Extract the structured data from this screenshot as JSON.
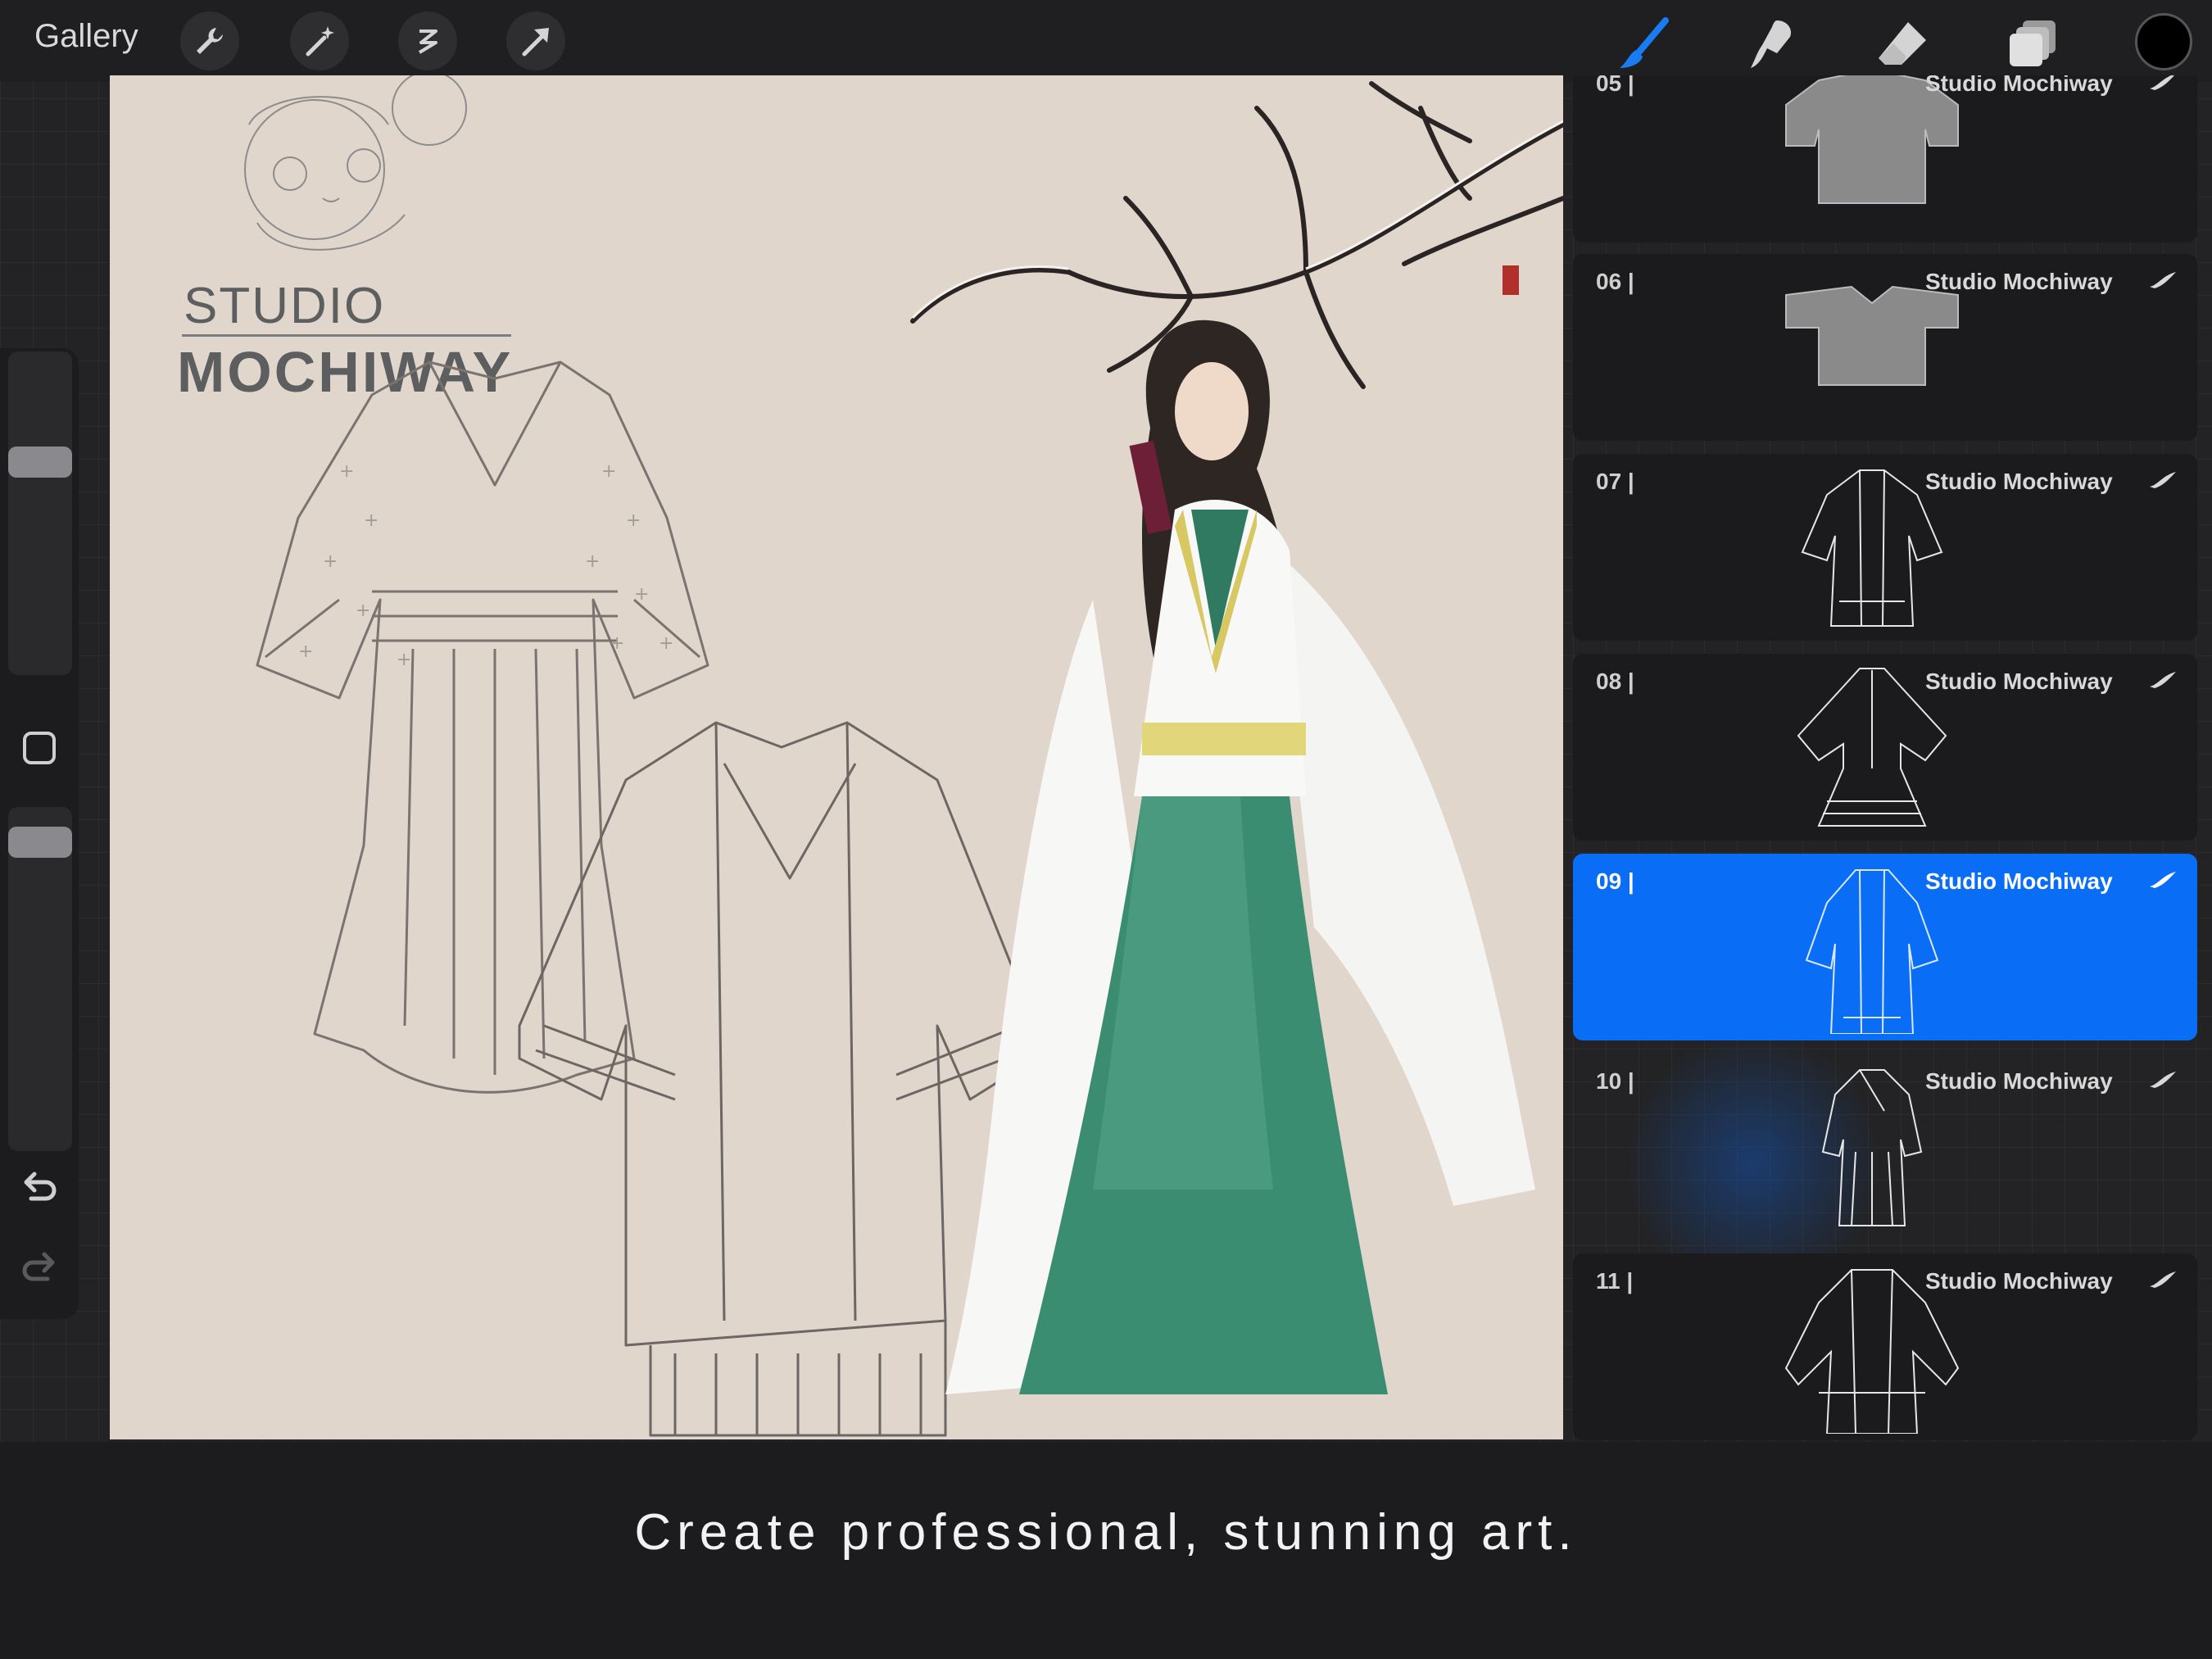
{
  "topbar": {
    "gallery_label": "Gallery",
    "left_tools": [
      "wrench-icon",
      "magic-wand-icon",
      "selection-icon",
      "transform-arrow-icon"
    ],
    "right_tools": [
      "brush-icon",
      "smudge-icon",
      "eraser-icon",
      "layers-icon"
    ],
    "active_tool": "brush-icon",
    "accent": "#1a7cf2",
    "current_color": "#000000"
  },
  "sidebar": {
    "controls": [
      "brush-size-slider",
      "modify-button",
      "opacity-slider",
      "undo-icon",
      "redo-icon"
    ]
  },
  "canvas": {
    "logo_line1": "STUDIO",
    "logo_line2": "MOCHIWAY"
  },
  "layers": {
    "items": [
      {
        "number": "05 |",
        "name": "Studio Mochiway",
        "active": false
      },
      {
        "number": "06 |",
        "name": "Studio Mochiway",
        "active": false
      },
      {
        "number": "07 |",
        "name": "Studio Mochiway",
        "active": false
      },
      {
        "number": "08 |",
        "name": "Studio Mochiway",
        "active": false
      },
      {
        "number": "09 |",
        "name": "Studio Mochiway",
        "active": true
      },
      {
        "number": "10 |",
        "name": "Studio Mochiway",
        "active": false
      },
      {
        "number": "11 |",
        "name": "Studio Mochiway",
        "active": false
      }
    ],
    "active_color": "#0a6df5"
  },
  "caption": "Create professional, stunning art."
}
